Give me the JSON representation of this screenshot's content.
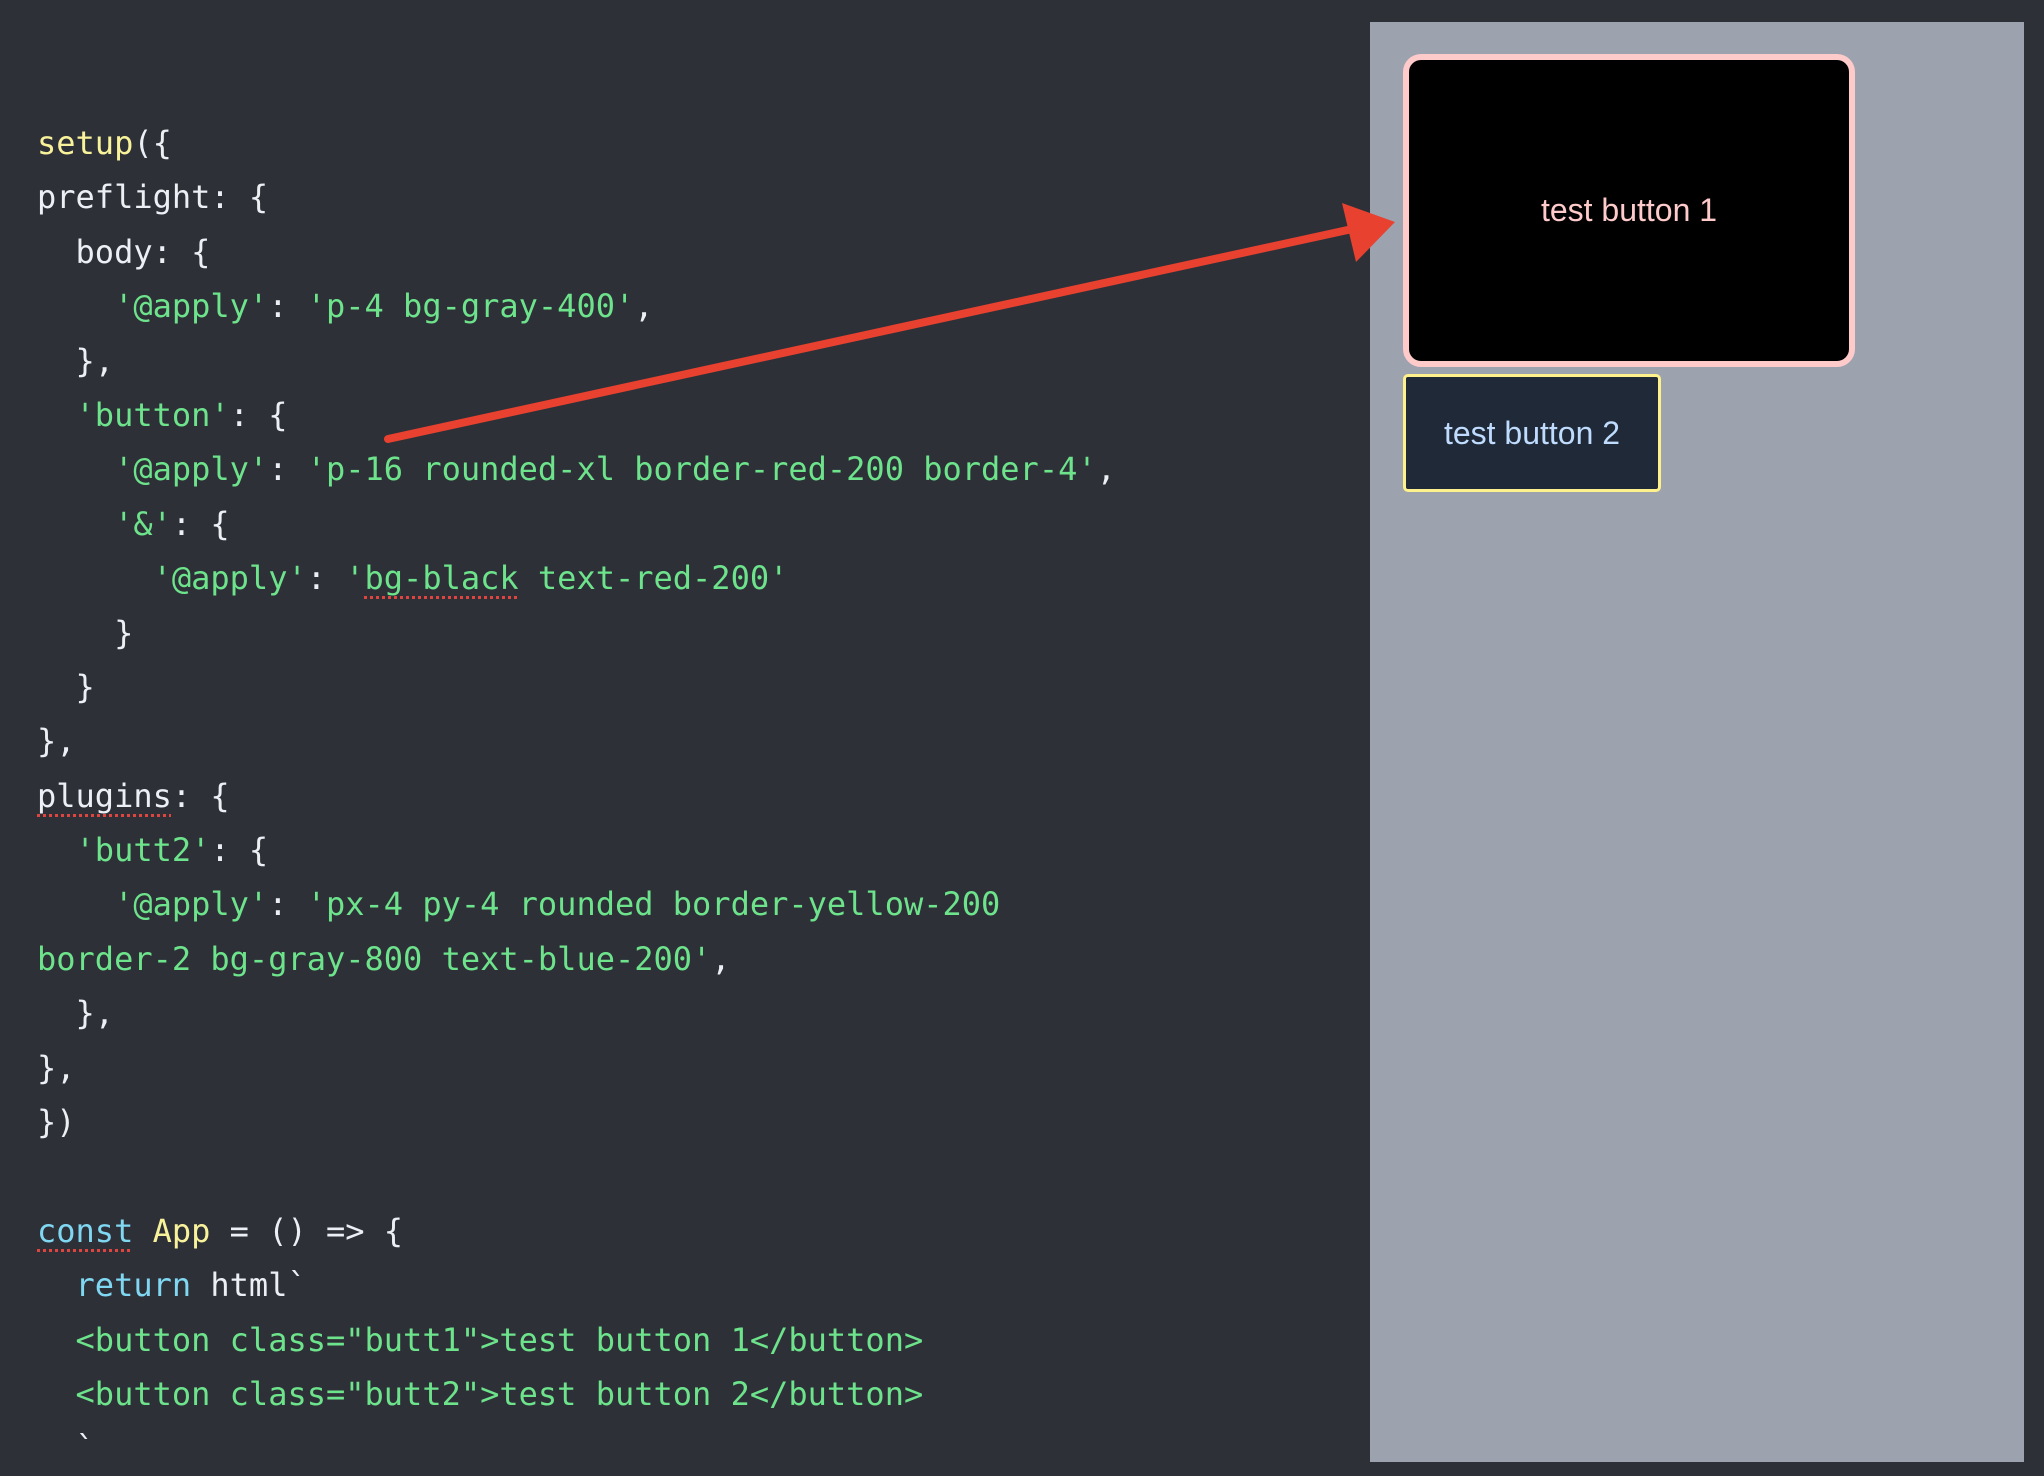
{
  "editor": {
    "lines": [
      [
        {
          "t": "setup",
          "c": "fn"
        },
        {
          "t": "({",
          "c": "plain"
        }
      ],
      [
        {
          "t": "preflight: {",
          "c": "plain"
        }
      ],
      [
        {
          "t": "  body: {",
          "c": "plain"
        }
      ],
      [
        {
          "t": "    ",
          "c": "plain"
        },
        {
          "t": "'@apply'",
          "c": "str"
        },
        {
          "t": ": ",
          "c": "plain"
        },
        {
          "t": "'p-4 bg-gray-400'",
          "c": "str"
        },
        {
          "t": ",",
          "c": "plain"
        }
      ],
      [
        {
          "t": "  },",
          "c": "plain"
        }
      ],
      [
        {
          "t": "  ",
          "c": "plain"
        },
        {
          "t": "'button'",
          "c": "str"
        },
        {
          "t": ": {",
          "c": "plain"
        }
      ],
      [
        {
          "t": "    ",
          "c": "plain"
        },
        {
          "t": "'@apply'",
          "c": "str"
        },
        {
          "t": ": ",
          "c": "plain"
        },
        {
          "t": "'p-16 rounded-xl border-red-200 border-4'",
          "c": "str"
        },
        {
          "t": ",",
          "c": "plain"
        }
      ],
      [
        {
          "t": "    ",
          "c": "plain"
        },
        {
          "t": "'&'",
          "c": "str"
        },
        {
          "t": ": {",
          "c": "plain"
        }
      ],
      [
        {
          "t": "      ",
          "c": "plain"
        },
        {
          "t": "'@apply'",
          "c": "str"
        },
        {
          "t": ": ",
          "c": "plain"
        },
        {
          "t": "'",
          "c": "str"
        },
        {
          "t": "bg-black",
          "c": "str",
          "squiggle": true
        },
        {
          "t": " text-red-200'",
          "c": "str"
        }
      ],
      [
        {
          "t": "    }",
          "c": "plain"
        }
      ],
      [
        {
          "t": "  }",
          "c": "plain"
        }
      ],
      [
        {
          "t": "},",
          "c": "plain"
        }
      ],
      [
        {
          "t": "plugins",
          "c": "plain",
          "squiggle": true
        },
        {
          "t": ": {",
          "c": "plain"
        }
      ],
      [
        {
          "t": "  ",
          "c": "plain"
        },
        {
          "t": "'butt2'",
          "c": "str"
        },
        {
          "t": ": {",
          "c": "plain"
        }
      ],
      [
        {
          "t": "    ",
          "c": "plain"
        },
        {
          "t": "'@apply'",
          "c": "str"
        },
        {
          "t": ": ",
          "c": "plain"
        },
        {
          "t": "'px-4 py-4 rounded border-yellow-200",
          "c": "str"
        }
      ],
      [
        {
          "t": "border-2 bg-gray-800 text-blue-200'",
          "c": "str"
        },
        {
          "t": ",",
          "c": "plain"
        }
      ],
      [
        {
          "t": "  },",
          "c": "plain"
        }
      ],
      [
        {
          "t": "},",
          "c": "plain"
        }
      ],
      [
        {
          "t": "})",
          "c": "plain"
        }
      ],
      [
        {
          "t": "",
          "c": "plain"
        }
      ],
      [
        {
          "t": "const",
          "c": "kw",
          "squiggle": true
        },
        {
          "t": " ",
          "c": "plain"
        },
        {
          "t": "App",
          "c": "fn"
        },
        {
          "t": " = () => {",
          "c": "plain"
        }
      ],
      [
        {
          "t": "  ",
          "c": "plain"
        },
        {
          "t": "return",
          "c": "kw"
        },
        {
          "t": " html`",
          "c": "plain"
        }
      ],
      [
        {
          "t": "  <button class=\"butt1\">test button 1</button>",
          "c": "str"
        }
      ],
      [
        {
          "t": "  <button class=\"butt2\">test button 2</button>",
          "c": "str"
        }
      ],
      [
        {
          "t": "  `",
          "c": "plain"
        }
      ]
    ]
  },
  "preview": {
    "button1_label": "test button 1",
    "button2_label": "test button 2"
  },
  "colors": {
    "editor_bg": "#2e3038",
    "preview_bg": "#9ca3af",
    "string": "#6de38b",
    "function": "#f8f29a",
    "keyword": "#7fd7f2",
    "annotation_arrow": "#e8412f",
    "red_200": "#fecaca",
    "yellow_200": "#fef08a",
    "blue_200": "#bfdbfe",
    "gray_800": "#1f2937"
  }
}
